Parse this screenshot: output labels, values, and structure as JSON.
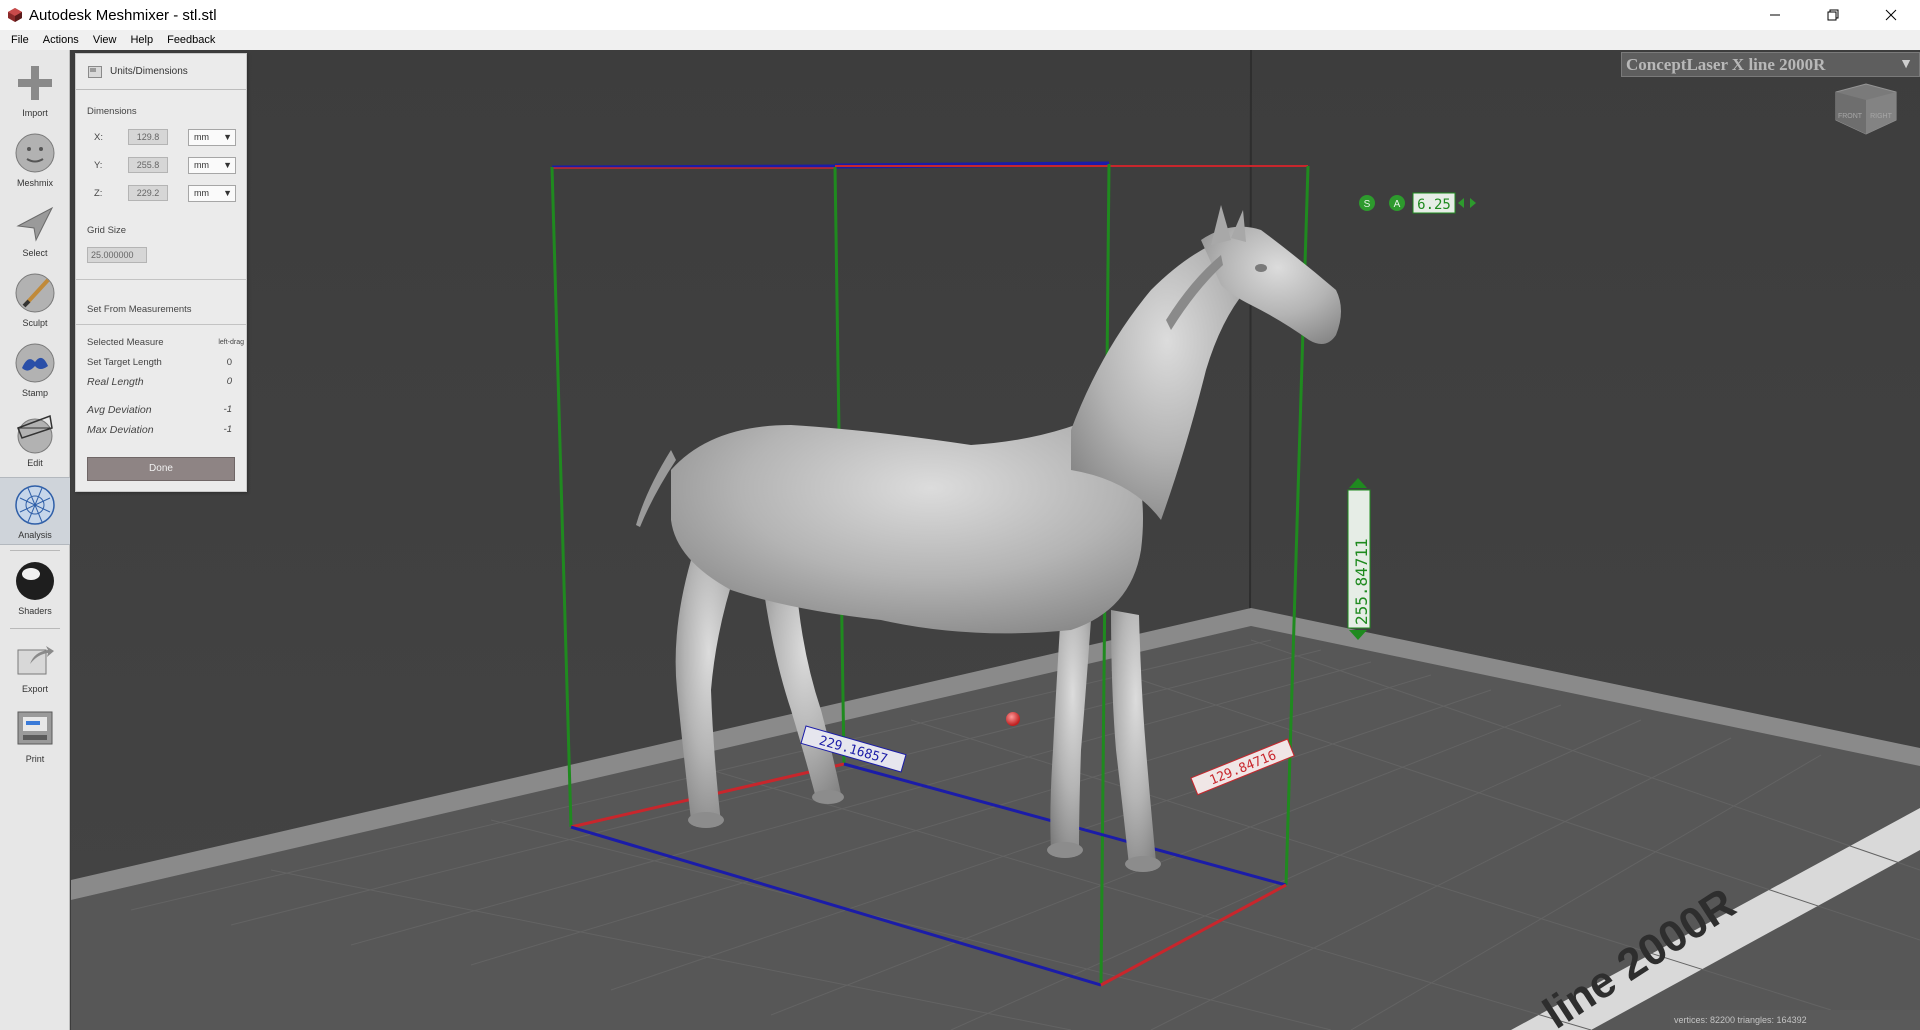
{
  "window": {
    "title": "Autodesk Meshmixer - stl.stl",
    "controls": [
      "minimize-icon",
      "restore-icon",
      "close-icon"
    ]
  },
  "menu": [
    "File",
    "Actions",
    "View",
    "Help",
    "Feedback"
  ],
  "toolbar": {
    "tools": [
      {
        "label": "Import",
        "icon": "plus-icon"
      },
      {
        "label": "Meshmix",
        "icon": "meshmix-sphere-icon"
      },
      {
        "label": "Select",
        "icon": "cursor-arrow-icon"
      },
      {
        "label": "Sculpt",
        "icon": "brush-icon"
      },
      {
        "label": "Stamp",
        "icon": "stamp-icon"
      },
      {
        "label": "Edit",
        "icon": "edit-mesh-icon"
      },
      {
        "label": "Analysis",
        "icon": "analysis-icon",
        "active": true
      },
      {
        "label": "Shaders",
        "icon": "shader-sphere-icon"
      },
      {
        "label": "Export",
        "icon": "export-icon"
      },
      {
        "label": "Print",
        "icon": "printer-icon"
      }
    ]
  },
  "panel": {
    "title": "Units/Dimensions",
    "dimensions_label": "Dimensions",
    "x": {
      "label": "X:",
      "value": "129.8",
      "unit": "mm"
    },
    "y": {
      "label": "Y:",
      "value": "255.8",
      "unit": "mm"
    },
    "z": {
      "label": "Z:",
      "value": "229.2",
      "unit": "mm"
    },
    "grid_size_label": "Grid Size",
    "grid_size_value": "25.000000",
    "set_from_measurements": "Set From Measurements",
    "selected_measure": {
      "label": "Selected Measure",
      "value": "left-drag"
    },
    "set_target_length": {
      "label": "Set Target Length",
      "value": "0"
    },
    "real_length": {
      "label": "Real Length",
      "value": "0"
    },
    "avg_deviation": {
      "label": "Avg Deviation",
      "value": "-1"
    },
    "max_deviation": {
      "label": "Max Deviation",
      "value": "-1"
    },
    "done_label": "Done"
  },
  "viewport": {
    "printer": "ConceptLaser X line 2000R",
    "bed_text": "line 2000R",
    "viewcube": {
      "front": "FRONT",
      "right": "RIGHT"
    },
    "measurements": {
      "height": "255.84711",
      "depth": "229.16857",
      "width": "129.84716"
    },
    "grid_controls": {
      "s_label": "S",
      "a_label": "A",
      "value": "6.25"
    },
    "status": "vertices: 82200  triangles: 164392",
    "colors": {
      "x_axis": "#c8262c",
      "y_axis": "#1b1ca8",
      "z_axis": "#1f8a1f"
    }
  }
}
